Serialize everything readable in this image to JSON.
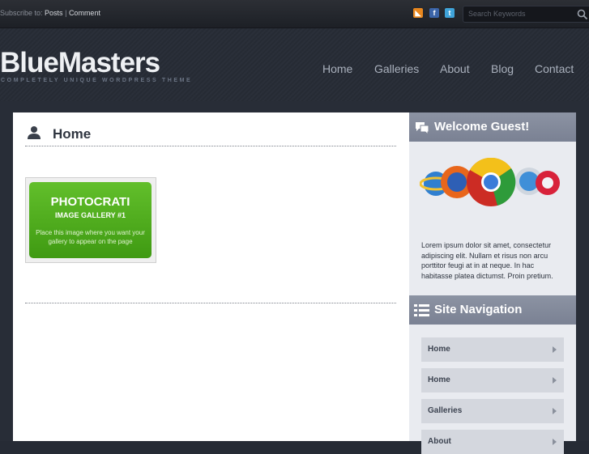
{
  "topbar": {
    "subscribe_prefix": "Subscribe to:",
    "posts_link": "Posts",
    "separator": "|",
    "comment_link": "Comment",
    "search_placeholder": "Search Keywords",
    "social": [
      "rss-icon",
      "facebook-icon",
      "twitter-icon"
    ],
    "rss_glyph": "◣",
    "facebook_glyph": "f",
    "twitter_glyph": "t"
  },
  "header": {
    "logo": "BlueMasters",
    "tagline": "COMPLETELY UNIQUE WORDPRESS THEME",
    "nav": [
      "Home",
      "Galleries",
      "About",
      "Blog",
      "Contact"
    ]
  },
  "main": {
    "page_title": "Home",
    "gallery_placeholder": {
      "title": "PHOTOCRATI",
      "subtitle": "IMAGE GALLERY #1",
      "note": "Place this image where you want your gallery to appear on the page"
    }
  },
  "sidebar": {
    "welcome_heading": "Welcome Guest!",
    "welcome_text": "Lorem ipsum dolor sit amet, consectetur adipiscing elit. Nullam et risus non arcu porttitor feugi at in at neque. In hac habitasse platea dictumst. Proin pretium.",
    "nav_heading": "Site Navigation",
    "nav_items": [
      "Home",
      "Home",
      "Galleries",
      "About"
    ]
  },
  "colors": {
    "background": "#262b35",
    "gallery_green": "#4fab1c",
    "sidebar_header": "#7f8696"
  }
}
